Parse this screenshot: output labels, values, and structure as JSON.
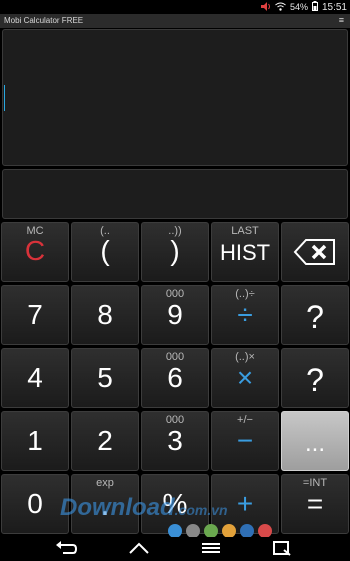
{
  "status": {
    "battery_pct": "54%",
    "time": "15:51",
    "icons": [
      "volume-icon",
      "wifi-icon",
      "battery-icon"
    ]
  },
  "app": {
    "title": "Mobi Calculator FREE",
    "menu_glyph": "≡"
  },
  "keys": {
    "r1": [
      {
        "sub": "MC",
        "main": "C"
      },
      {
        "sub": "(..",
        "main": "("
      },
      {
        "sub": "..))",
        "main": ")"
      },
      {
        "sub": "LAST",
        "main": "HIST"
      },
      {
        "sub": "",
        "main": "backspace"
      }
    ],
    "r2": [
      {
        "sub": "",
        "main": "7"
      },
      {
        "sub": "",
        "main": "8"
      },
      {
        "sub": "000",
        "main": "9"
      },
      {
        "sub": "(..)÷",
        "main": "÷"
      },
      {
        "sub": "",
        "main": "?"
      }
    ],
    "r3": [
      {
        "sub": "",
        "main": "4"
      },
      {
        "sub": "",
        "main": "5"
      },
      {
        "sub": "000",
        "main": "6"
      },
      {
        "sub": "(..)×",
        "main": "×"
      },
      {
        "sub": "",
        "main": "?"
      }
    ],
    "r4": [
      {
        "sub": "",
        "main": "1"
      },
      {
        "sub": "",
        "main": "2"
      },
      {
        "sub": "000",
        "main": "3"
      },
      {
        "sub": "+/−",
        "main": "−"
      },
      {
        "sub": "",
        "main": "..."
      }
    ],
    "r5": [
      {
        "sub": "",
        "main": "0"
      },
      {
        "sub": "exp",
        "main": "."
      },
      {
        "sub": "",
        "main": "%"
      },
      {
        "sub": "",
        "main": "+"
      },
      {
        "sub": "=INT",
        "main": "="
      }
    ]
  },
  "watermark": {
    "text": "Download",
    "suffix": ".com.vn"
  },
  "colors": {
    "accent_red": "#d8323a",
    "accent_blue": "#3a9de0"
  }
}
